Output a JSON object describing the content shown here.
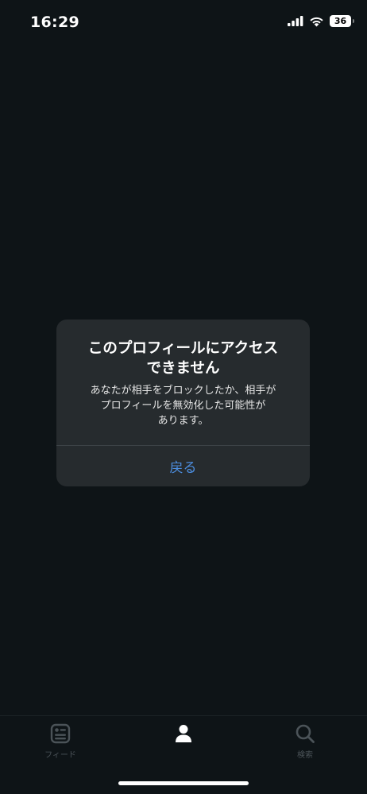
{
  "status_bar": {
    "time": "16:29",
    "battery": "36",
    "icons": [
      "signal-icon",
      "wifi-icon",
      "battery-icon"
    ]
  },
  "alert": {
    "title_line1": "このプロフィールにアクセス",
    "title_line2": "できません",
    "message_line1": "あなたが相手をブロックしたか、相手が",
    "message_line2": "プロフィールを無効化した可能性が",
    "message_line3": "あります。",
    "button_label": "戻る"
  },
  "tab_bar": {
    "tabs": [
      {
        "label": "フィード",
        "icon": "feed-icon"
      },
      {
        "label": "",
        "icon": "profile-icon"
      },
      {
        "label": "検索",
        "icon": "search-icon"
      }
    ]
  },
  "colors": {
    "background": "#0e1417",
    "dialog": "#262b2e",
    "accent": "#4c8ee0",
    "tab_inactive": "#4b5358"
  }
}
